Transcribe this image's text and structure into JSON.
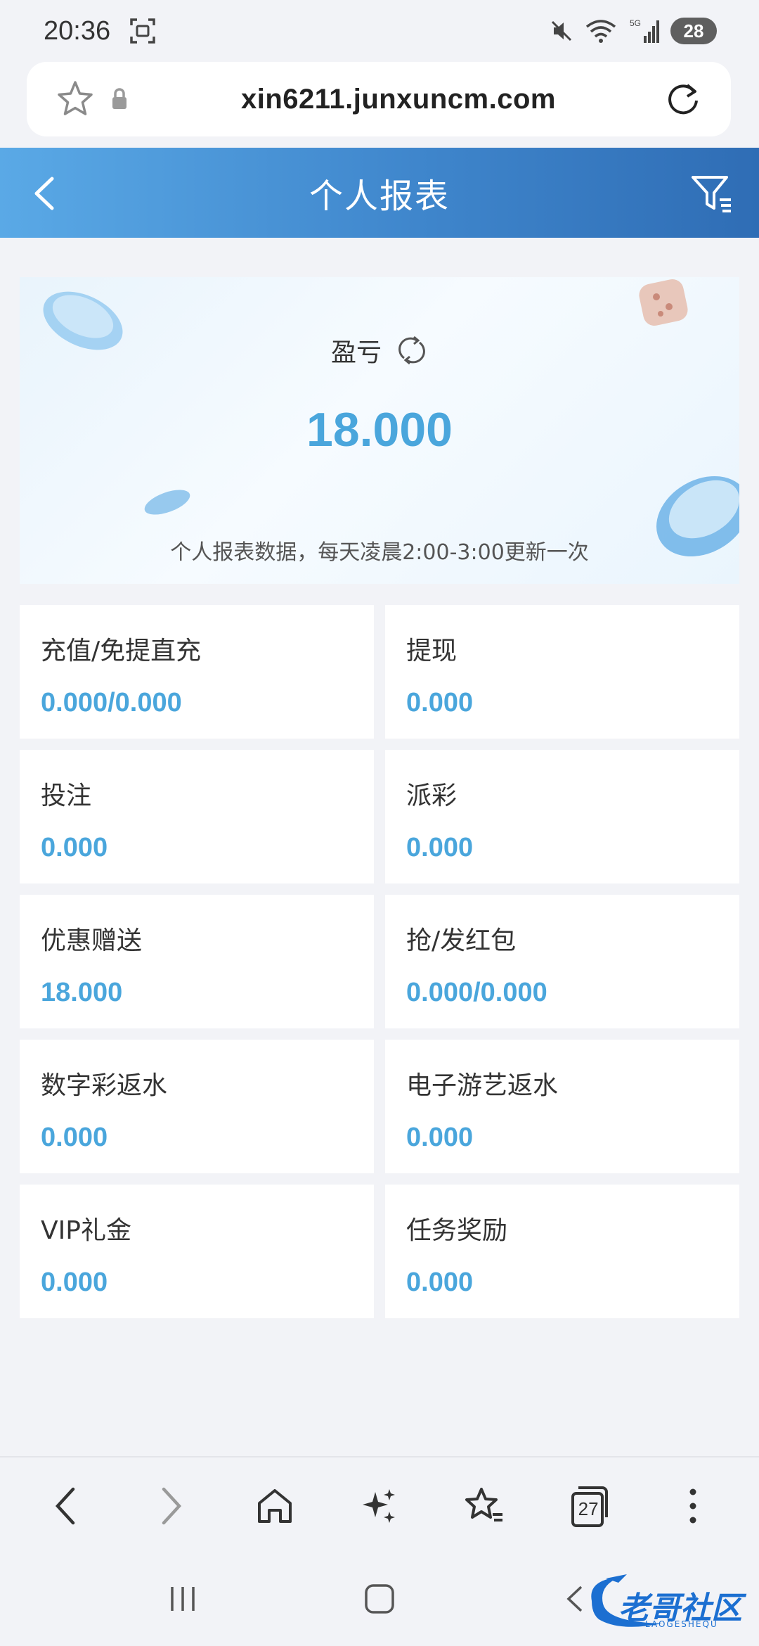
{
  "status_bar": {
    "time": "20:36",
    "battery": "28",
    "network": "5G"
  },
  "browser": {
    "url": "xin6211.junxuncm.com",
    "tabs_count": "27"
  },
  "header": {
    "title": "个人报表"
  },
  "summary": {
    "label": "盈亏",
    "value": "18.000",
    "note": "个人报表数据，每天凌晨2:00-3:00更新一次"
  },
  "stats": [
    {
      "label": "充值/免提直充",
      "value": "0.000/0.000"
    },
    {
      "label": "提现",
      "value": "0.000"
    },
    {
      "label": "投注",
      "value": "0.000"
    },
    {
      "label": "派彩",
      "value": "0.000"
    },
    {
      "label": "优惠赠送",
      "value": "18.000"
    },
    {
      "label": "抢/发红包",
      "value": "0.000/0.000"
    },
    {
      "label": "数字彩返水",
      "value": "0.000"
    },
    {
      "label": "电子游艺返水",
      "value": "0.000"
    },
    {
      "label": "VIP礼金",
      "value": "0.000"
    },
    {
      "label": "任务奖励",
      "value": "0.000"
    }
  ],
  "watermark": {
    "text": "老哥社区",
    "sub": "LAOGESHEQU"
  },
  "colors": {
    "accent": "#4aa6dc",
    "header_start": "#5aa9e6",
    "header_end": "#2f6db5",
    "background": "#f2f3f7"
  }
}
